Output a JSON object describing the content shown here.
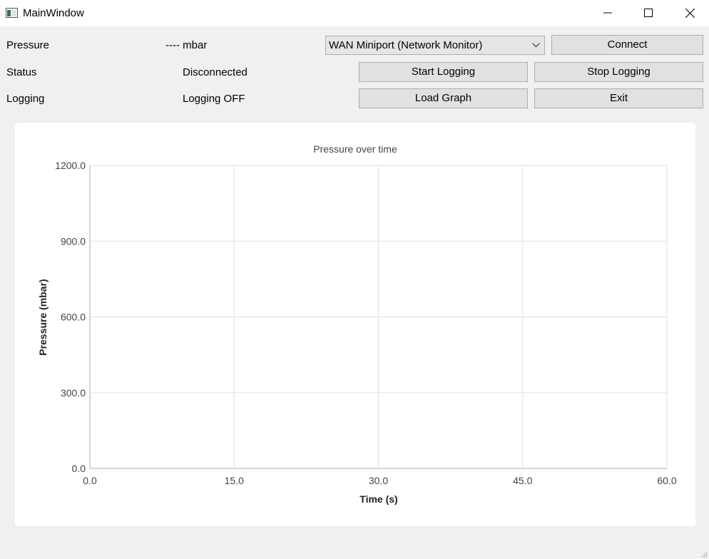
{
  "window": {
    "title": "MainWindow"
  },
  "rows": {
    "pressure_label": "Pressure",
    "pressure_value": "---- mbar",
    "status_label": "Status",
    "status_value": "Disconnected",
    "logging_label": "Logging",
    "logging_value": "Logging OFF"
  },
  "controls": {
    "port_selected": "WAN Miniport (Network Monitor)",
    "connect": "Connect",
    "start_logging": "Start Logging",
    "stop_logging": "Stop Logging",
    "load_graph": "Load Graph",
    "exit": "Exit"
  },
  "icons": {
    "app": "app-window-icon",
    "minimize": "minimize-icon",
    "maximize": "maximize-icon",
    "close": "close-icon",
    "dropdown": "chevron-down-icon",
    "grip": "resize-grip-icon"
  },
  "chart_data": {
    "type": "line",
    "title": "Pressure over time",
    "xlabel": "Time (s)",
    "ylabel": "Pressure (mbar)",
    "xlim": [
      0,
      60
    ],
    "ylim": [
      0,
      1200
    ],
    "xticks": [
      "0.0",
      "15.0",
      "30.0",
      "45.0",
      "60.0"
    ],
    "yticks": [
      "0.0",
      "300.0",
      "600.0",
      "900.0",
      "1200.0"
    ],
    "grid": true,
    "series": []
  }
}
